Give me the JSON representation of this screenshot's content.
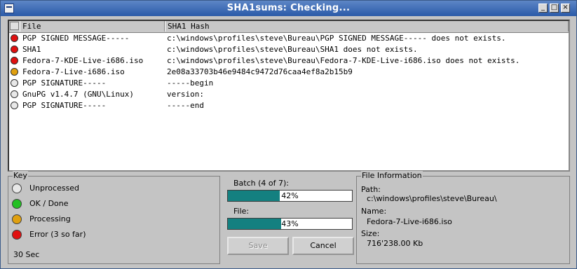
{
  "window": {
    "title": "SHA1sums: Checking..."
  },
  "list": {
    "headers": {
      "file": "File",
      "hash": "SHA1 Hash"
    },
    "rows": [
      {
        "status": "error",
        "file": "PGP SIGNED MESSAGE-----",
        "hash": "c:\\windows\\profiles\\steve\\Bureau\\PGP SIGNED MESSAGE----- does not exists."
      },
      {
        "status": "error",
        "file": "SHA1",
        "hash": "c:\\windows\\profiles\\steve\\Bureau\\SHA1 does not exists."
      },
      {
        "status": "error",
        "file": "Fedora-7-KDE-Live-i686.iso",
        "hash": "c:\\windows\\profiles\\steve\\Bureau\\Fedora-7-KDE-Live-i686.iso does not exists."
      },
      {
        "status": "processing",
        "file": "Fedora-7-Live-i686.iso",
        "hash": "2e08a33703b46e9484c9472d76caa4ef8a2b15b9"
      },
      {
        "status": "unprocessed",
        "file": "PGP SIGNATURE-----",
        "hash": "-----begin"
      },
      {
        "status": "unprocessed",
        "file": "GnuPG v1.4.7 (GNU\\Linux)",
        "hash": "version:"
      },
      {
        "status": "unprocessed",
        "file": "PGP SIGNATURE-----",
        "hash": "-----end"
      }
    ]
  },
  "status_colors": {
    "unprocessed": "#e8e8e8",
    "ok": "#22c022",
    "processing": "#e0a010",
    "error": "#e01010"
  },
  "key": {
    "legend": "Key",
    "items": [
      {
        "status": "unprocessed",
        "label": "Unprocessed"
      },
      {
        "status": "ok",
        "label": "OK / Done"
      },
      {
        "status": "processing",
        "label": "Processing"
      },
      {
        "status": "error",
        "label": "Error  (3 so far)"
      }
    ],
    "elapsed": "30 Sec"
  },
  "progress": {
    "batch_label": "Batch (4 of 7):",
    "batch_percent": 42,
    "batch_text": "42%",
    "file_label": "File:",
    "file_percent": 43,
    "file_text": "43%",
    "save_label": "Save",
    "cancel_label": "Cancel"
  },
  "file_info": {
    "legend": "File Information",
    "path_label": "Path:",
    "path": "c:\\windows\\profiles\\steve\\Bureau\\",
    "name_label": "Name:",
    "name": "Fedora-7-Live-i686.iso",
    "size_label": "Size:",
    "size": "716'238.00 Kb"
  }
}
